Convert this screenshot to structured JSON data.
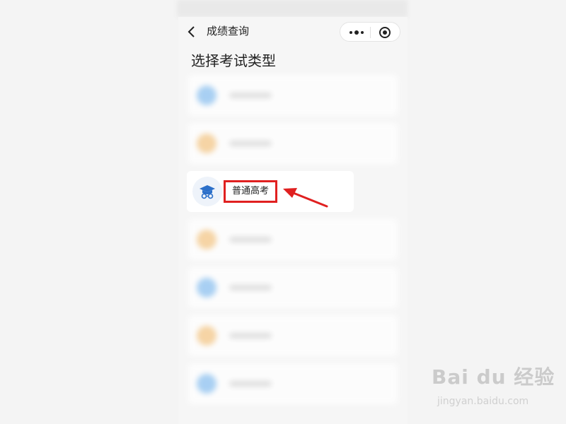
{
  "navbar": {
    "title": "成绩查询",
    "back_icon": "chevron-left-icon",
    "more_icon": "more-dots-icon",
    "close_icon": "target-circle-icon"
  },
  "page": {
    "heading": "选择考试类型"
  },
  "exam_types": {
    "featured_label": "普通高考",
    "featured_icon": "graduation-cap-icon"
  },
  "colors": {
    "blue": "#8fc3f2",
    "orange": "#f6c98a",
    "highlight_red": "#e02020",
    "cap_blue": "#2b6fc9"
  },
  "watermark": {
    "logo": "Bai du 经验",
    "url": "jingyan.baidu.com"
  }
}
